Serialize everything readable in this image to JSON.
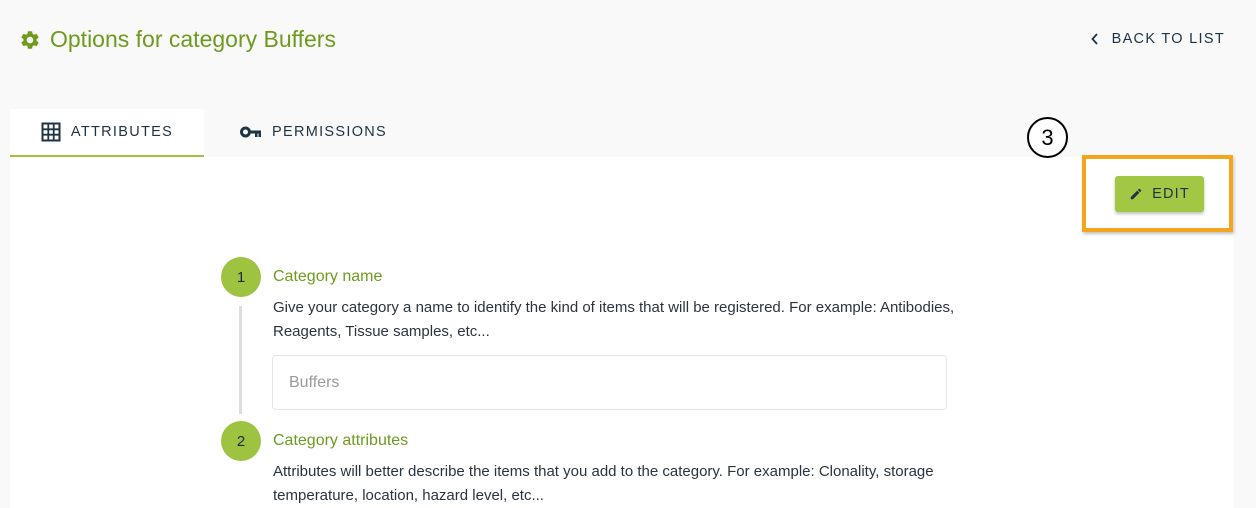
{
  "header": {
    "title": "Options for category Buffers",
    "back_label": "BACK TO LIST"
  },
  "tabs": [
    {
      "label": "ATTRIBUTES",
      "icon": "grid-icon",
      "active": true
    },
    {
      "label": "PERMISSIONS",
      "icon": "key-icon",
      "active": false
    }
  ],
  "callout": {
    "number": "3"
  },
  "toolbar": {
    "edit_label": "EDIT",
    "edit_icon": "pencil-icon"
  },
  "steps": [
    {
      "number": "1",
      "title": "Category name",
      "description": "Give your category a name to identify the kind of items that will be registered. For example: Antibodies, Reagents, Tissue samples, etc...",
      "input": {
        "value": "",
        "placeholder": "Buffers"
      }
    },
    {
      "number": "2",
      "title": "Category attributes",
      "description": "Attributes will better describe the items that you add to the category. For example: Clonality, storage temperature, location, hazard level, etc..."
    }
  ],
  "colors": {
    "accent_green": "#9ec341",
    "title_green": "#6e9a1d",
    "highlight_orange": "#f3a51b",
    "text_dark": "#1f3344"
  }
}
